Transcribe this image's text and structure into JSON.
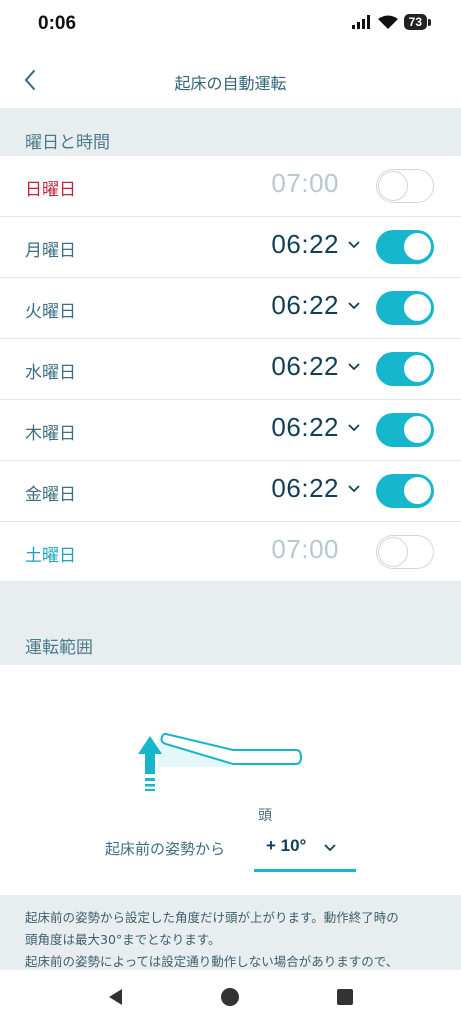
{
  "status": {
    "time": "0:06",
    "battery": "73"
  },
  "header": {
    "title": "起床の自動運転"
  },
  "schedule": {
    "section_title": "曜日と時間",
    "days": [
      {
        "label": "日曜日",
        "time": "07:00",
        "enabled": false
      },
      {
        "label": "月曜日",
        "time": "06:22",
        "enabled": true
      },
      {
        "label": "火曜日",
        "time": "06:22",
        "enabled": true
      },
      {
        "label": "水曜日",
        "time": "06:22",
        "enabled": true
      },
      {
        "label": "木曜日",
        "time": "06:22",
        "enabled": true
      },
      {
        "label": "金曜日",
        "time": "06:22",
        "enabled": true
      },
      {
        "label": "土曜日",
        "time": "07:00",
        "enabled": false
      }
    ]
  },
  "range": {
    "section_title": "運転範囲",
    "head_label": "頭",
    "posture_label": "起床前の姿勢から",
    "angle_value": "+ 10°"
  },
  "note": {
    "line1": "起床前の姿勢から設定した角度だけ頭が上がります。動作終了時の",
    "line2": "頭角度は最大30°までとなります。",
    "line3": "起床前の姿勢によっては設定通り動作しない場合がありますので、"
  },
  "colors": {
    "accent": "#16b7cc",
    "sunday": "#c0253a",
    "saturday": "#1aa3c0",
    "section_bg": "#e8eef0"
  }
}
